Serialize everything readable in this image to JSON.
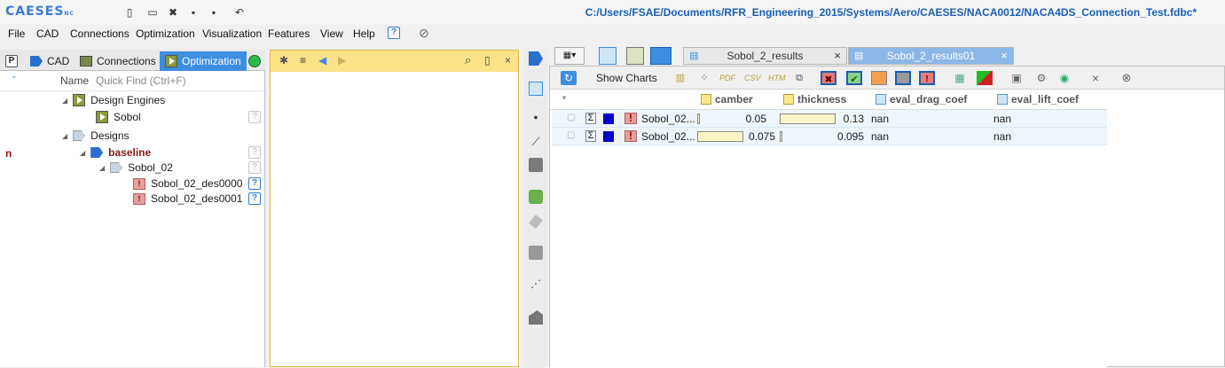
{
  "app": {
    "logo": "CAESES",
    "logo_sup": "NC",
    "filepath": "C:/Users/FSAE/Documents/RFR_Engineering_2015/Systems/Aero/CAESES/NACA0012/NACA4DS_Connection_Test.fdbc*"
  },
  "menu": [
    "File",
    "CAD",
    "Connections",
    "Optimization",
    "Visualization",
    "Features",
    "View",
    "Help"
  ],
  "left_tabs": {
    "p": "P",
    "cad": "CAD",
    "connections": "Connections",
    "optimization": "Optimization"
  },
  "tree": {
    "name_label": "Name",
    "quick_find": "Quick Find (Ctrl+F)",
    "cut_letter": "n",
    "design_engines": "Design Engines",
    "sobol": "Sobol",
    "designs": "Designs",
    "baseline": "baseline",
    "sobol_02": "Sobol_02",
    "des0": "Sobol_02_des0000",
    "des1": "Sobol_02_des0001",
    "hint": "?"
  },
  "right_tabs": {
    "tab1": "Sobol_2_results",
    "tab2": "Sobol_2_results01",
    "close": "×"
  },
  "toolbar": {
    "show_charts": "Show Charts",
    "pdf": "PDF",
    "csv": "CSV",
    "htm": "HTM"
  },
  "table": {
    "columns": [
      "camber",
      "thickness",
      "eval_drag_coef",
      "eval_lift_coef"
    ],
    "rows": [
      {
        "name": "Sobol_02...",
        "camber": "0.05",
        "camber_fill": 0.06,
        "thickness": "0.13",
        "thickness_fill": 1.0,
        "drag": "nan",
        "lift": "nan"
      },
      {
        "name": "Sobol_02...",
        "camber": "0.075",
        "camber_fill": 1.0,
        "thickness": "0.095",
        "thickness_fill": 0.05,
        "drag": "nan",
        "lift": "nan"
      }
    ]
  },
  "colors": {
    "accent": "#3d8ee0",
    "path": "#1a5fb4",
    "baseline": "#8b1a1a",
    "midbar": "#fde28a"
  }
}
